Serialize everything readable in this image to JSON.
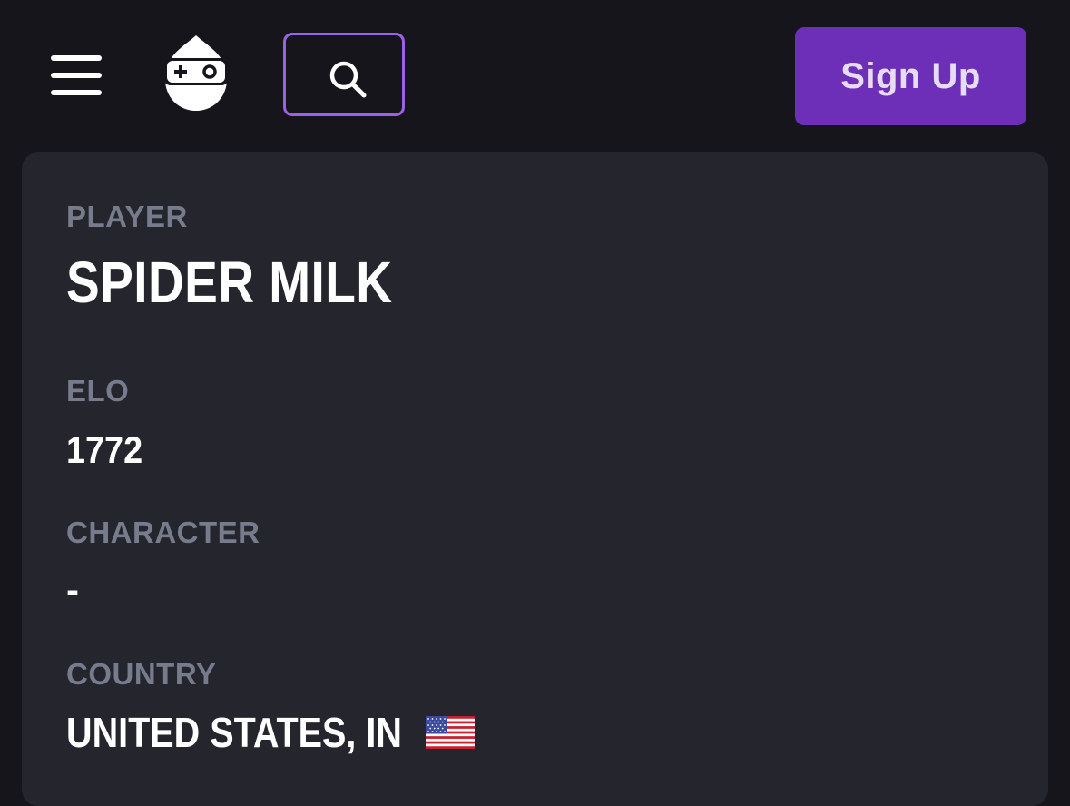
{
  "header": {
    "menu_icon": "hamburger-menu-icon",
    "logo_icon": "gamepad-mascot-logo",
    "search_icon": "search-icon",
    "signup_label": "Sign Up",
    "colors": {
      "background": "#16151b",
      "search_border": "#9a62e8",
      "signup_bg": "#6d2fb8",
      "signup_text": "#e6dcf5"
    }
  },
  "profile": {
    "player_label": "PLAYER",
    "player_name": "SPIDER MILK",
    "elo_label": "ELO",
    "elo_value": "1772",
    "character_label": "CHARACTER",
    "character_value": "-",
    "country_label": "COUNTRY",
    "country_value": "UNITED STATES, IN",
    "country_flag_icon": "us-flag-icon",
    "colors": {
      "card_bg": "#25252e",
      "label": "#777c8c",
      "value": "#ffffff"
    }
  }
}
